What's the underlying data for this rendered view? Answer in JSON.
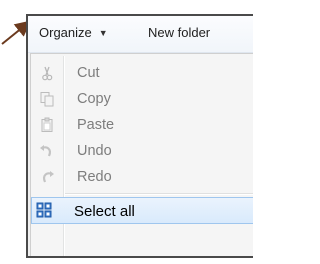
{
  "toolbar": {
    "organize_label": "Organize",
    "organize_caret": "▼",
    "new_folder_label": "New folder"
  },
  "menu": {
    "items": [
      {
        "label": "Cut",
        "icon": "scissors-icon",
        "enabled": false
      },
      {
        "label": "Copy",
        "icon": "copy-icon",
        "enabled": false
      },
      {
        "label": "Paste",
        "icon": "paste-icon",
        "enabled": false
      },
      {
        "label": "Undo",
        "icon": "undo-icon",
        "enabled": false
      },
      {
        "label": "Redo",
        "icon": "redo-icon",
        "enabled": false
      },
      {
        "label": "Select all",
        "icon": "select-all-icon",
        "enabled": true,
        "highlighted": true
      }
    ]
  },
  "colors": {
    "frame": "#4a4a4a",
    "highlight_border": "#9fc6ee",
    "disabled_text": "#7d7d7d",
    "arrow": "#6b3a1e"
  }
}
